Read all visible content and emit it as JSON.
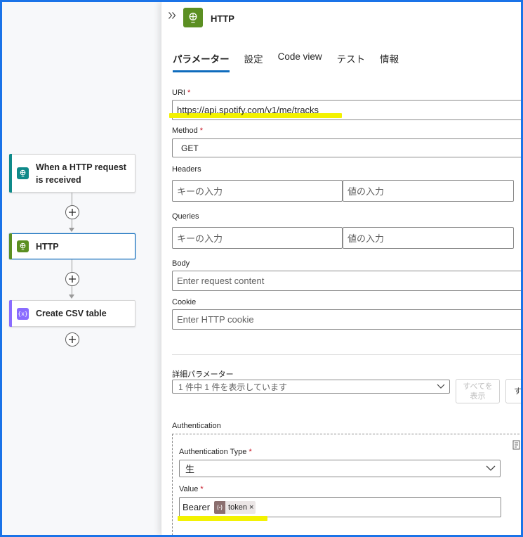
{
  "flow": {
    "trigger": {
      "title_line1": "When a HTTP request",
      "title_line2": "is received"
    },
    "http": {
      "title": "HTTP"
    },
    "csv": {
      "title": "Create CSV table",
      "icon_text": "{x}"
    }
  },
  "panel": {
    "title": "HTTP",
    "tabs": [
      "パラメーター",
      "設定",
      "Code view",
      "テスト",
      "情報"
    ],
    "uri": {
      "label": "URI",
      "required": "*",
      "value": "https://api.spotify.com/v1/me/tracks"
    },
    "method": {
      "label": "Method",
      "required": "*",
      "value": "GET"
    },
    "headers": {
      "label": "Headers",
      "key_placeholder": "キーの入力",
      "value_placeholder": "値の入力"
    },
    "queries": {
      "label": "Queries",
      "key_placeholder": "キーの入力",
      "value_placeholder": "値の入力"
    },
    "body": {
      "label": "Body",
      "placeholder": "Enter request content"
    },
    "cookie": {
      "label": "Cookie",
      "placeholder": "Enter HTTP cookie"
    },
    "advanced": {
      "label": "詳細パラメーター",
      "dropdown_text": "1 件中 1 件を表示しています",
      "show_all_line1": "すべてを",
      "show_all_line2": "表示",
      "clear_partial": "す"
    },
    "authentication": {
      "label": "Authentication",
      "type_label": "Authentication Type",
      "type_required": "*",
      "type_value": "生",
      "value_label": "Value",
      "value_required": "*",
      "value_text": "Bearer",
      "token_label": "token",
      "token_remove": "×"
    }
  },
  "colors": {
    "trigger": "#0f8a8a",
    "http": "#5b8f22",
    "csv": "#8a6cff",
    "accent": "#0f6cbd",
    "highlight": "#f3f200"
  }
}
